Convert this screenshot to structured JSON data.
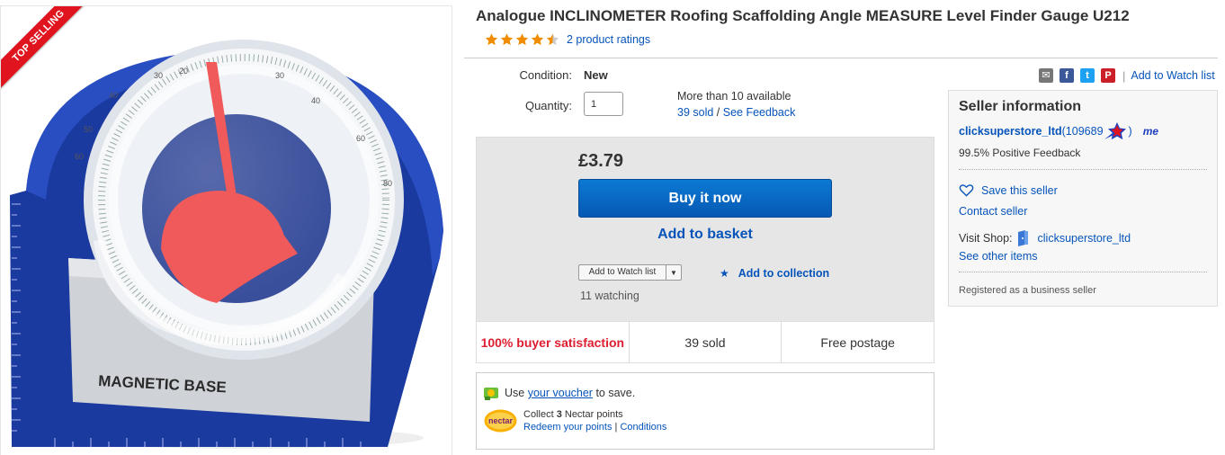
{
  "badge": {
    "top_selling": "TOP SELLING"
  },
  "product": {
    "title": "Analogue INCLINOMETER Roofing Scaffolding Angle MEASURE Level Finder Gauge U212",
    "ratings_text": "2 product ratings",
    "rating_value": 4.5,
    "image_label": "MAGNETIC BASE"
  },
  "purchase": {
    "condition_label": "Condition:",
    "condition_value": "New",
    "quantity_label": "Quantity:",
    "quantity_value": "1",
    "availability": "More than 10 available",
    "sold_link": "39 sold",
    "sold_sep": " / ",
    "feedback_link": "See Feedback",
    "price": "£3.79",
    "buy_now": "Buy it now",
    "add_to_basket": "Add to basket",
    "watch_list_select": "Add to Watch list",
    "add_to_collection": "Add to collection",
    "watching": "11 watching"
  },
  "stats": {
    "satisfaction": "100% buyer satisfaction",
    "sold": "39 sold",
    "postage": "Free postage"
  },
  "voucher": {
    "use_text": "Use ",
    "voucher_link": "your voucher",
    "save_text": " to save.",
    "nectar_logo": "nectar",
    "collect_prefix": "Collect ",
    "collect_points": "3",
    "collect_suffix": " Nectar points",
    "redeem_link": "Redeem your points",
    "sep": " | ",
    "conditions_link": "Conditions"
  },
  "share": {
    "add_to_watch_list": "Add to Watch list",
    "sep": "|"
  },
  "seller": {
    "title": "Seller information",
    "name": "clicksuperstore_ltd",
    "score_open": " (109689",
    "score_close": " )",
    "me_badge": "me",
    "positive_feedback": "99.5% Positive Feedback",
    "save_seller": "Save this seller",
    "contact_seller": "Contact seller",
    "visit_shop_label": "Visit Shop:",
    "shop_name": "clicksuperstore_ltd",
    "see_other_items": "See other items",
    "registered": "Registered as a business seller"
  },
  "colors": {
    "link": "#0654ba",
    "buy_button": "#0659b3",
    "red": "#dd1e31",
    "star": "#f18c00"
  }
}
